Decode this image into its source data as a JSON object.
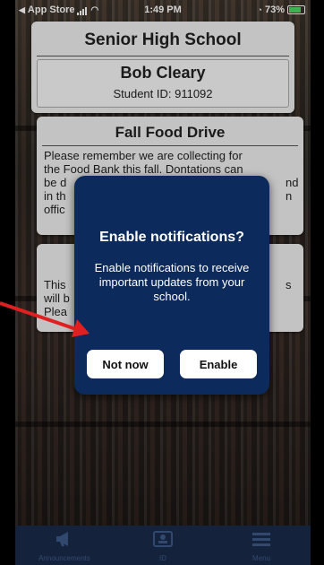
{
  "status_bar": {
    "carrier": "App Store",
    "time": "1:49 PM",
    "battery": "73%",
    "battery_level": 0.73
  },
  "school": {
    "name": "Senior High School",
    "student_name": "Bob Cleary",
    "student_id": "Student ID: 911092"
  },
  "posts": [
    {
      "title": "Fall Food Drive",
      "body_lines": [
        "Please remember we are collecting for",
        "the Food Bank this fall. Dontations can",
        "be d",
        "in th",
        "offic"
      ],
      "body_lines_right": [
        "nd",
        "n"
      ]
    },
    {
      "body_lines": [
        "This",
        "will b",
        "Plea"
      ],
      "body_lines_right": [
        "s"
      ]
    }
  ],
  "modal": {
    "title": "Enable notifications?",
    "body": "Enable notifications to receive important updates from your school.",
    "decline_label": "Not now",
    "accept_label": "Enable"
  },
  "tabs": [
    {
      "label": "Announcements",
      "icon": "megaphone-icon"
    },
    {
      "label": "ID",
      "icon": "id-card-icon"
    },
    {
      "label": "Menu",
      "icon": "hamburger-menu-icon"
    }
  ],
  "colors": {
    "modal_bg": "#0c2a5c",
    "tabbar_bg": "#1a2a4a",
    "arrow": "#e02020"
  }
}
